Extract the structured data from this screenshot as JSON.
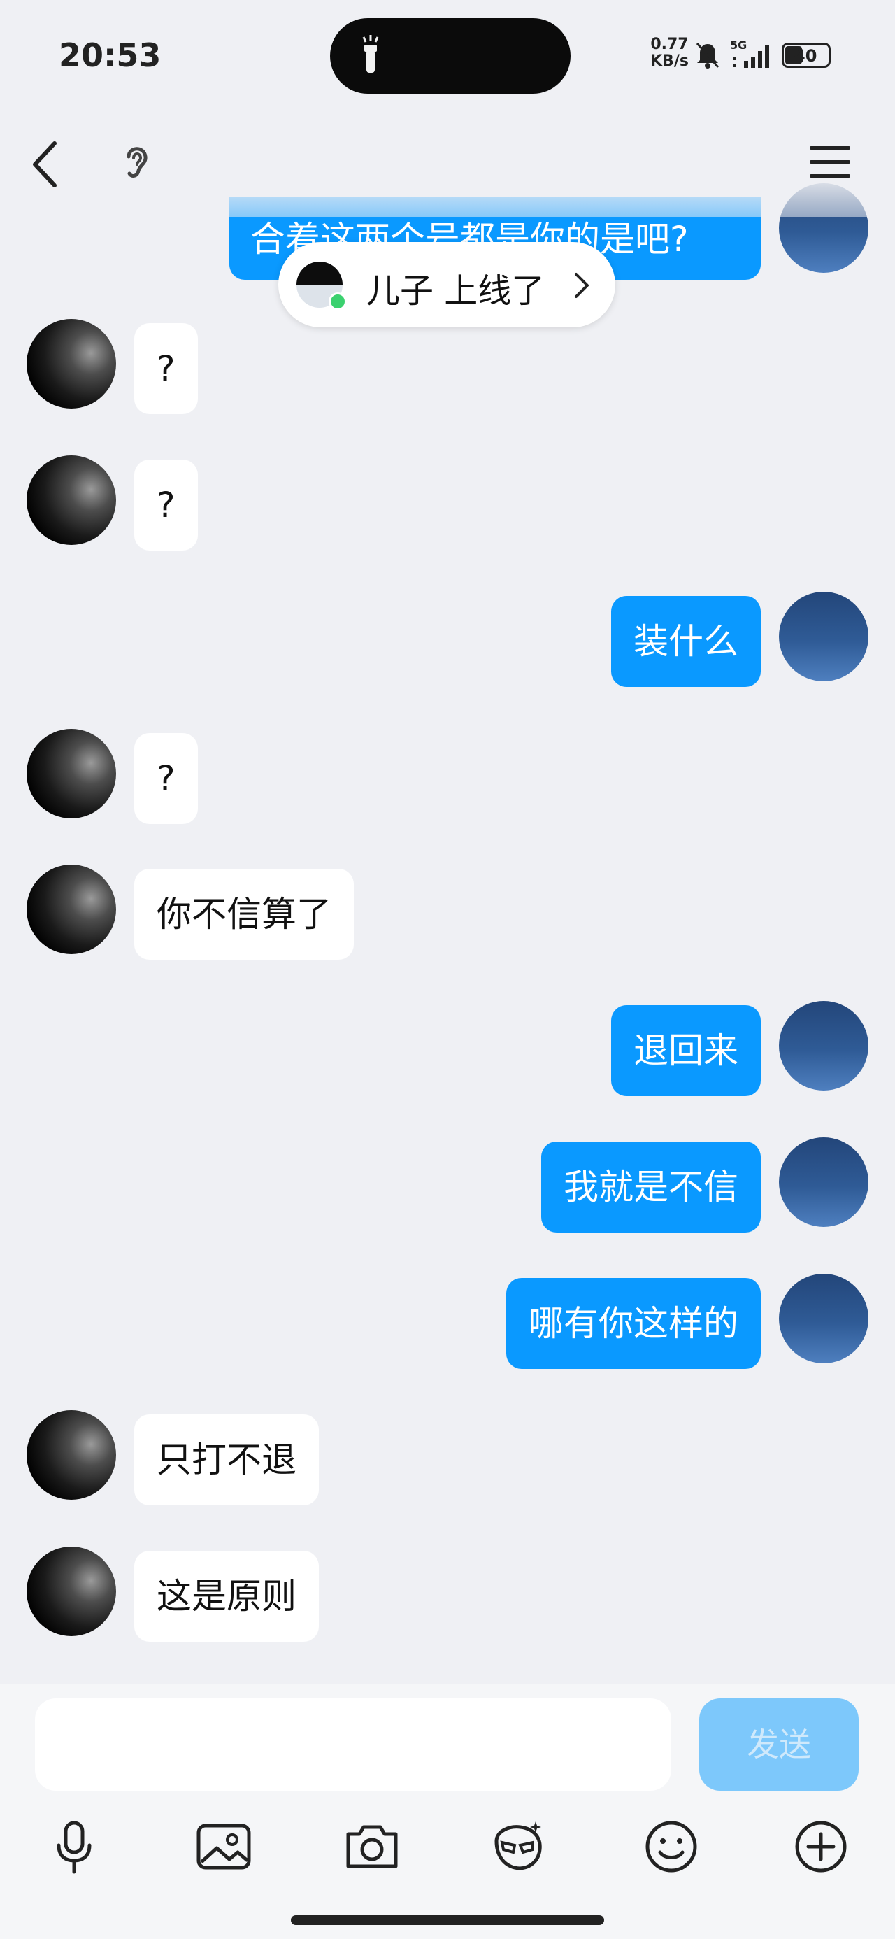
{
  "status_bar": {
    "time": "20:53",
    "net_speed_value": "0.77",
    "net_speed_unit": "KB/s",
    "signal_label": "5G",
    "battery": "40"
  },
  "header": {
    "back_icon": "chevron-left-icon",
    "earpiece_icon": "ear-icon",
    "menu_icon": "hamburger-menu-icon"
  },
  "online_notice": {
    "text": "儿子 上线了",
    "chevron_icon": "chevron-right-icon"
  },
  "messages": [
    {
      "side": "right",
      "text": "合着这两个号都是你的是吧?"
    },
    {
      "side": "left",
      "text": "?"
    },
    {
      "side": "left",
      "text": "?"
    },
    {
      "side": "right",
      "text": "装什么"
    },
    {
      "side": "left",
      "text": "?"
    },
    {
      "side": "left",
      "text": "你不信算了"
    },
    {
      "side": "right",
      "text": "退回来"
    },
    {
      "side": "right",
      "text": "我就是不信"
    },
    {
      "side": "right",
      "text": "哪有你这样的"
    },
    {
      "side": "left",
      "text": "只打不退"
    },
    {
      "side": "left",
      "text": "这是原则"
    }
  ],
  "composer": {
    "input_value": "",
    "send_label": "发送",
    "send_enabled": false
  },
  "toolbar": [
    {
      "icon": "microphone-icon"
    },
    {
      "icon": "image-icon"
    },
    {
      "icon": "camera-icon"
    },
    {
      "icon": "sticker-face-icon"
    },
    {
      "icon": "emoji-icon"
    },
    {
      "icon": "plus-icon"
    }
  ],
  "colors": {
    "background": "#eff0f4",
    "outgoing_bubble": "#0a99ff",
    "incoming_bubble": "#ffffff",
    "send_button_disabled": "#7dc8fb"
  }
}
